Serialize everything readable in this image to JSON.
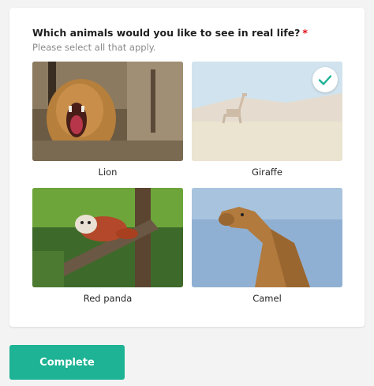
{
  "question": {
    "title": "Which animals would you like to see in real life?",
    "required_marker": "*",
    "hint": "Please select all that apply."
  },
  "choices": [
    {
      "label": "Lion",
      "selected": false,
      "image": "lion-photo"
    },
    {
      "label": "Giraffe",
      "selected": true,
      "image": "giraffe-photo"
    },
    {
      "label": "Red panda",
      "selected": false,
      "image": "red-panda-photo"
    },
    {
      "label": "Camel",
      "selected": false,
      "image": "camel-photo"
    }
  ],
  "actions": {
    "complete_label": "Complete"
  },
  "colors": {
    "accent": "#1db394",
    "required": "#e50914",
    "check": "#1db394"
  }
}
